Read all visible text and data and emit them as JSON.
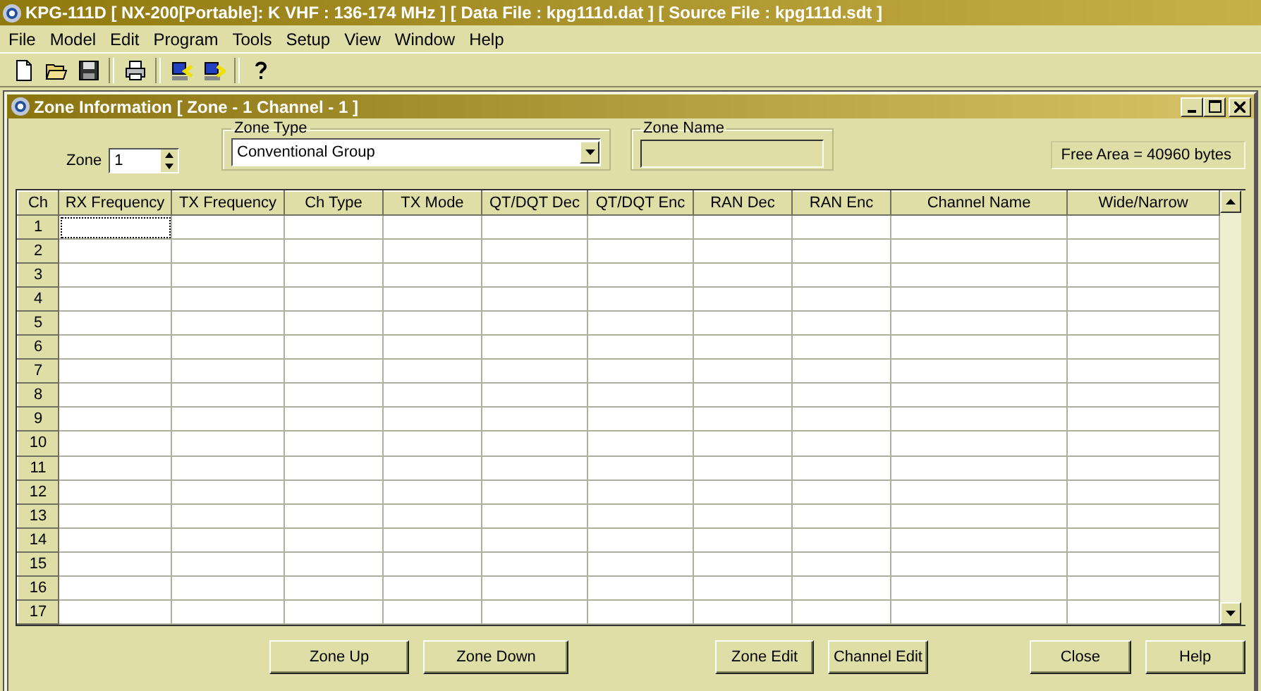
{
  "window": {
    "title": "KPG-111D  [ NX-200[Portable]: K VHF : 136-174 MHz ] [ Data File : kpg111d.dat ] [ Source File : kpg111d.sdt ]"
  },
  "menu": [
    "File",
    "Model",
    "Edit",
    "Program",
    "Tools",
    "Setup",
    "View",
    "Window",
    "Help"
  ],
  "toolbar": [
    {
      "kind": "new"
    },
    {
      "kind": "open"
    },
    {
      "kind": "save"
    },
    {
      "kind": "sep"
    },
    {
      "kind": "print"
    },
    {
      "kind": "sep"
    },
    {
      "kind": "read"
    },
    {
      "kind": "write"
    },
    {
      "kind": "sep"
    },
    {
      "kind": "help"
    }
  ],
  "child": {
    "title": "Zone Information [ Zone - 1  Channel - 1 ]",
    "zone": {
      "label": "Zone",
      "value": "1"
    },
    "zone_type": {
      "label": "Zone Type",
      "value": "Conventional Group"
    },
    "zone_name": {
      "label": "Zone Name"
    },
    "free_area": "Free Area = 40960 bytes",
    "table": {
      "columns": [
        "Ch",
        "RX Frequency",
        "TX Frequency",
        "Ch Type",
        "TX Mode",
        "QT/DQT Dec",
        "QT/DQT Enc",
        "RAN Dec",
        "RAN Enc",
        "Channel Name",
        "Wide/Narrow"
      ],
      "rows": [
        "1",
        "2",
        "3",
        "4",
        "5",
        "6",
        "7",
        "8",
        "9",
        "10",
        "11",
        "12",
        "13",
        "14",
        "15",
        "16",
        "17"
      ]
    },
    "buttons": [
      "Zone Up",
      "Zone Down",
      "Zone Edit",
      "Channel Edit",
      "Close",
      "Help"
    ]
  }
}
